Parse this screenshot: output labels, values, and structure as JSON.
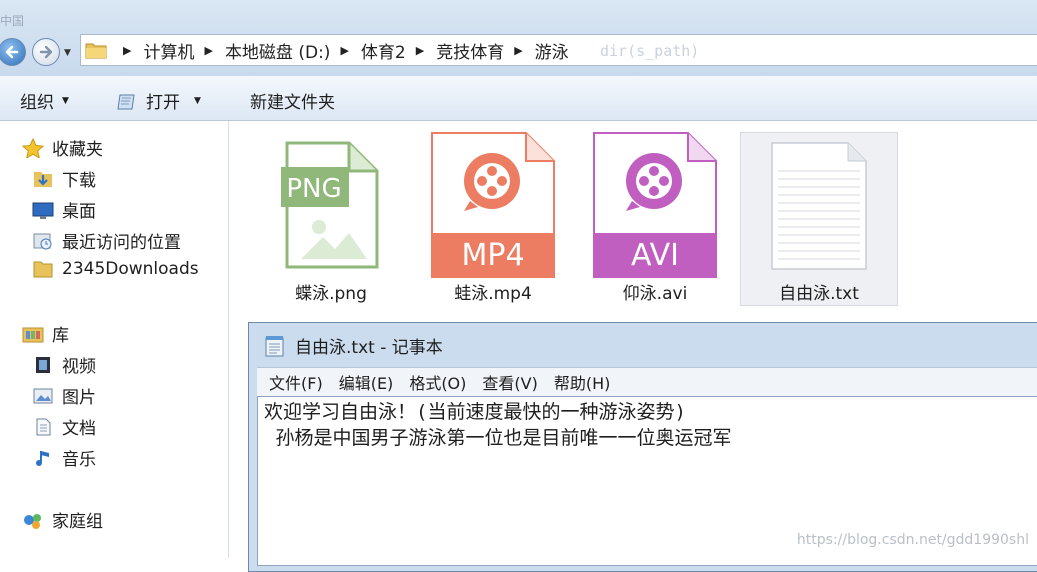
{
  "window": {
    "ghost_title": "中国"
  },
  "address": {
    "crumbs": [
      "计算机",
      "本地磁盘 (D:)",
      "体育2",
      "竞技体育",
      "游泳"
    ],
    "faint_overlay": "dir(s_path)"
  },
  "toolbar": {
    "organize": "组织",
    "open": "打开",
    "new_folder": "新建文件夹"
  },
  "sidebar": {
    "favorites": "收藏夹",
    "fav_items": [
      "下载",
      "桌面",
      "最近访问的位置",
      "2345Downloads"
    ],
    "libraries": "库",
    "lib_items": [
      "视频",
      "图片",
      "文档",
      "音乐"
    ],
    "homegroup": "家庭组"
  },
  "files": [
    {
      "name": "蝶泳.png",
      "badge": "PNG",
      "color": "#8fb87a"
    },
    {
      "name": "蛙泳.mp4",
      "badge": "MP4",
      "color": "#ec7d62"
    },
    {
      "name": "仰泳.avi",
      "badge": "AVI",
      "color": "#c05fc0"
    },
    {
      "name": "自由泳.txt",
      "badge": "",
      "color": "#d0d4da"
    }
  ],
  "notepad": {
    "title": "自由泳.txt - 记事本",
    "menus": [
      "文件(F)",
      "编辑(E)",
      "格式(O)",
      "查看(V)",
      "帮助(H)"
    ],
    "line1": "欢迎学习自由泳！(当前速度最快的一种游泳姿势)",
    "line2": " 孙杨是中国男子游泳第一位也是目前唯一一位奥运冠军"
  },
  "watermark": "https://blog.csdn.net/gdd1990shl"
}
